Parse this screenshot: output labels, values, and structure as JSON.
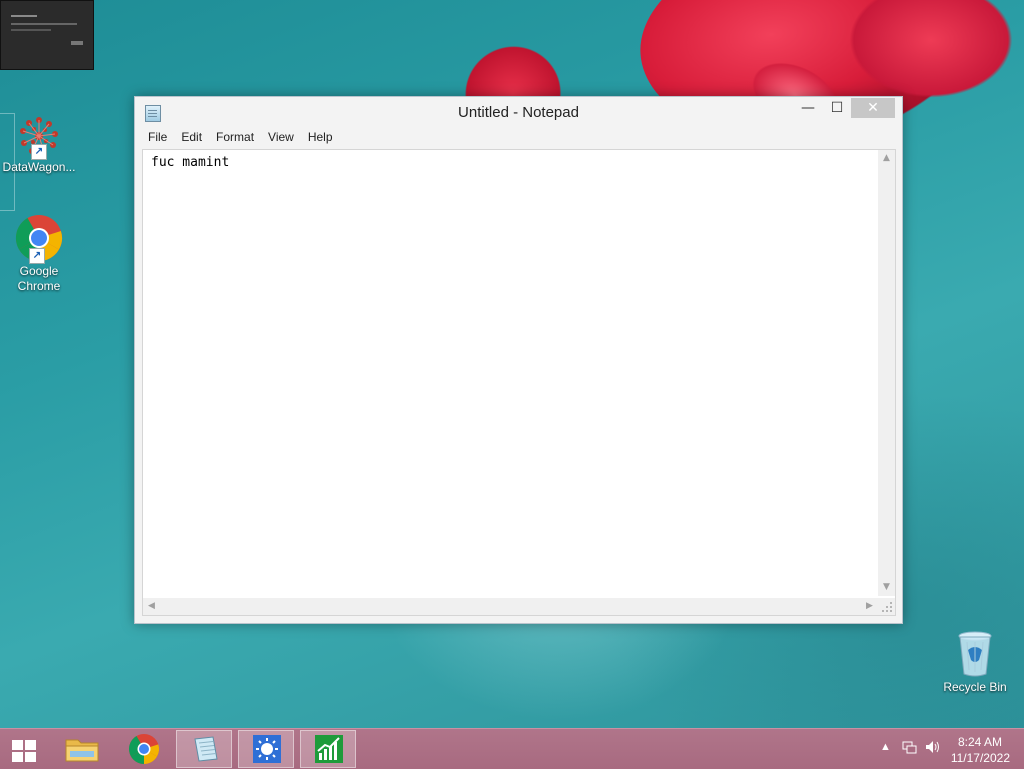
{
  "window": {
    "title": "Untitled - Notepad",
    "minimize_symbol": "—",
    "maximize_symbol": "☐",
    "close_symbol": "✕"
  },
  "menu": [
    "File",
    "Edit",
    "Format",
    "View",
    "Help"
  ],
  "editor": {
    "content": "fuc mamint"
  },
  "desktop_icons": {
    "datawagon": "DataWagon...",
    "chrome": "Google Chrome",
    "recycle_bin": "Recycle Bin"
  },
  "taskbar": {
    "items": [
      "start-icon",
      "file-explorer-icon",
      "chrome-icon",
      "notepad-icon",
      "settings-sun-icon",
      "stock-chart-icon"
    ],
    "tray_arrow": "▲",
    "time": "8:24 AM",
    "date": "11/17/2022"
  },
  "colors": {
    "desktop": "#2a9da5",
    "taskbar": "#a86a80",
    "close_button": "#c7c7c7"
  }
}
